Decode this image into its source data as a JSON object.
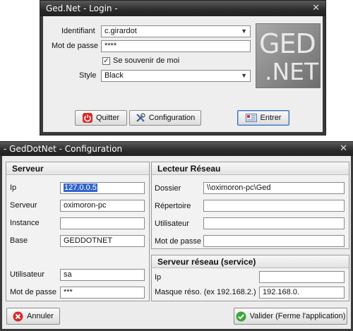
{
  "login": {
    "title": "Ged.Net - Login -",
    "identifiant_label": "Identifiant",
    "identifiant_value": "c.girardot",
    "password_label": "Mot de passe",
    "password_value": "****",
    "remember_label": "Se souvenir de moi",
    "remember_checked": true,
    "style_label": "Style",
    "style_value": "Black",
    "logo_line1": "GED",
    "logo_line2": ".NET",
    "quit_label": "Quitter",
    "config_label": "Configuration",
    "enter_label": "Entrer"
  },
  "config": {
    "title": "- GedDotNet - Configuration",
    "serveur": {
      "title": "Serveur",
      "ip_label": "Ip",
      "ip_value": "127.0.0.5",
      "serveur_label": "Serveur",
      "serveur_value": "oximoron-pc",
      "instance_label": "Instance",
      "instance_value": "",
      "base_label": "Base",
      "base_value": "GEDDOTNET",
      "user_label": "Utilisateur",
      "user_value": "sa",
      "password_label": "Mot de passe",
      "password_value": "***"
    },
    "lecteur": {
      "title": "Lecteur Réseau",
      "dossier_label": "Dossier",
      "dossier_value": "\\\\oximoron-pc\\Ged",
      "repertoire_label": "Répertoire",
      "repertoire_value": "",
      "user_label": "Utilisateur",
      "user_value": "",
      "password_label": "Mot de passe",
      "password_value": ""
    },
    "service": {
      "title": "Serveur réseau (service)",
      "ip_label": "Ip",
      "ip_value": "",
      "mask_label": "Masque réso. (ex 192.168.2.)",
      "mask_value": "192.168.0."
    },
    "cancel_label": "Annuler",
    "validate_label": "Valider (Ferme l'application)"
  }
}
